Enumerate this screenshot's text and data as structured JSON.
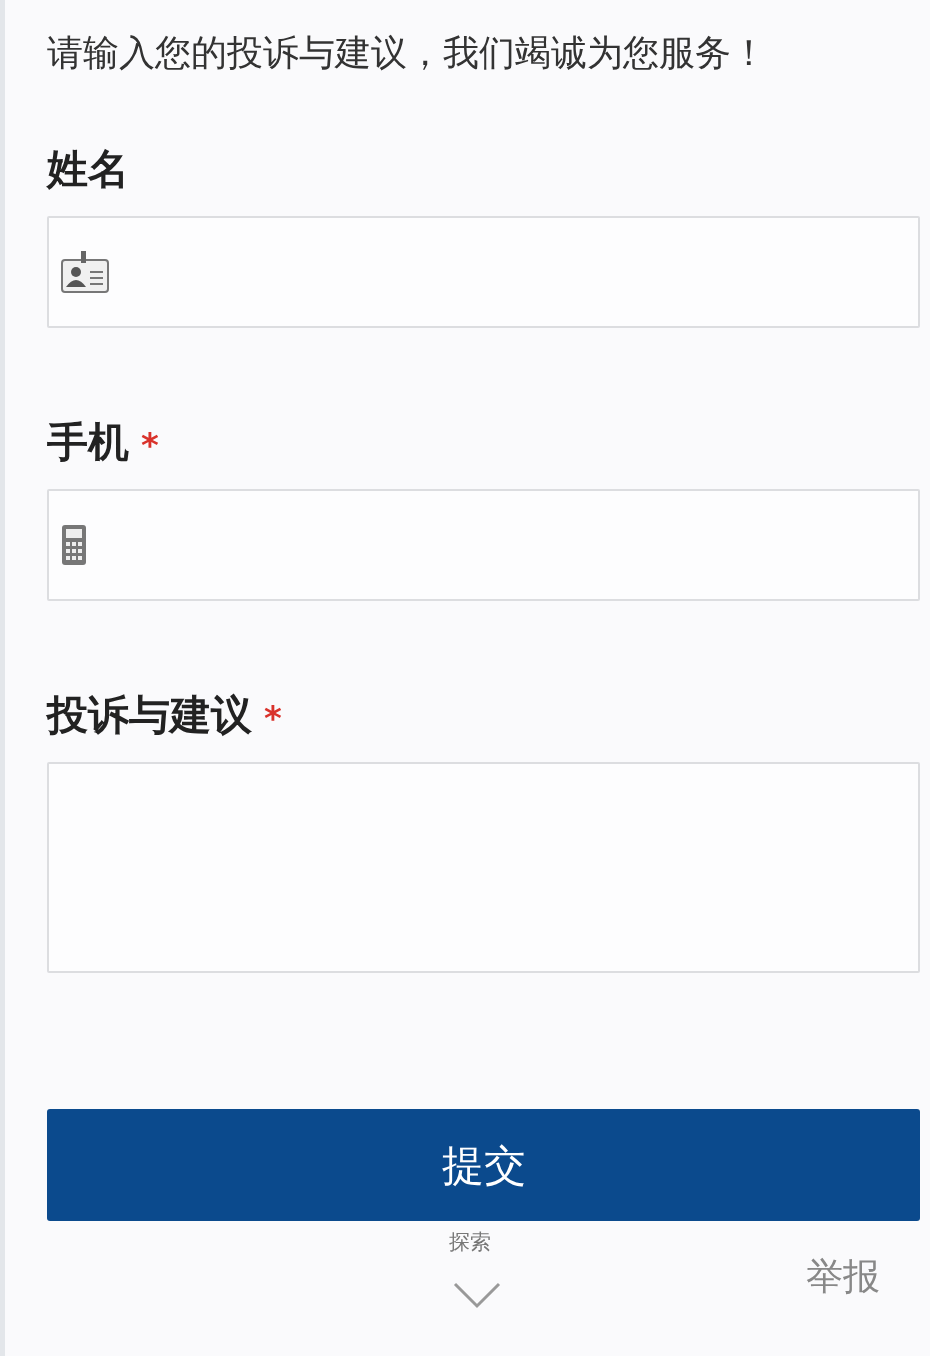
{
  "intro": "请输入您的投诉与建议，我们竭诚为您服务！",
  "fields": [
    {
      "label": "姓名",
      "kind": "name"
    },
    {
      "label": "手机",
      "required_mark": "*",
      "kind": "phone"
    },
    {
      "label": "投诉与建议",
      "required_mark": "*",
      "kind": "textarea"
    }
  ],
  "submit": "提交",
  "explore": "探索",
  "report": "举报"
}
